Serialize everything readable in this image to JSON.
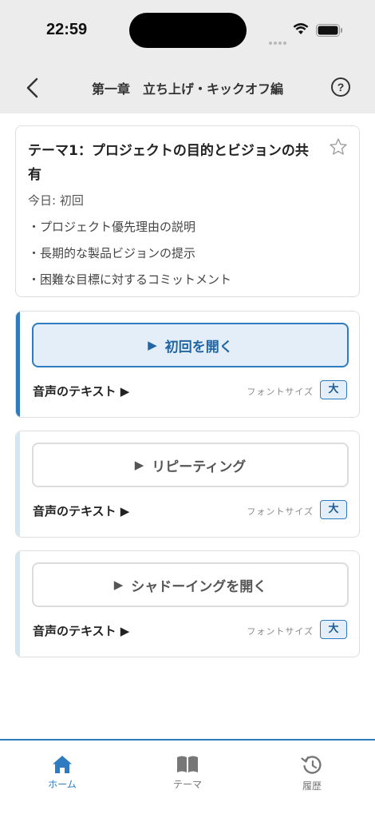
{
  "status_bar": {
    "time": "22:59"
  },
  "nav": {
    "title": "第一章　立ち上げ・キックオフ編",
    "help_label": "?"
  },
  "theme": {
    "title": "テーマ1：プロジェクトの目的とビジョンの共有",
    "today": "今日: 初回",
    "bullets": [
      "・プロジェクト優先理由の説明",
      "・長期的な製品ビジョンの提示",
      "・困難な目標に対するコミットメント"
    ],
    "favorite_icon": "star-outline"
  },
  "actions": [
    {
      "label": "初回を開く",
      "audio_text": "音声のテキスト ▶",
      "font_size_label": "フォントサイズ",
      "font_size_value": "大",
      "active": true
    },
    {
      "label": "リピーティング",
      "audio_text": "音声のテキスト ▶",
      "font_size_label": "フォントサイズ",
      "font_size_value": "大",
      "active": false
    },
    {
      "label": "シャドーイングを開く",
      "audio_text": "音声のテキスト ▶",
      "font_size_label": "フォントサイズ",
      "font_size_value": "大",
      "active": false
    }
  ],
  "tabs": [
    {
      "label": "ホーム",
      "icon": "home-icon",
      "active": true
    },
    {
      "label": "テーマ",
      "icon": "book-icon",
      "active": false
    },
    {
      "label": "履歴",
      "icon": "history-icon",
      "active": false
    }
  ],
  "colors": {
    "accent": "#2e7cbf",
    "accent_light": "#e3eef9",
    "inactive_accent": "#d6e6f1",
    "header_bg": "#ececec"
  }
}
